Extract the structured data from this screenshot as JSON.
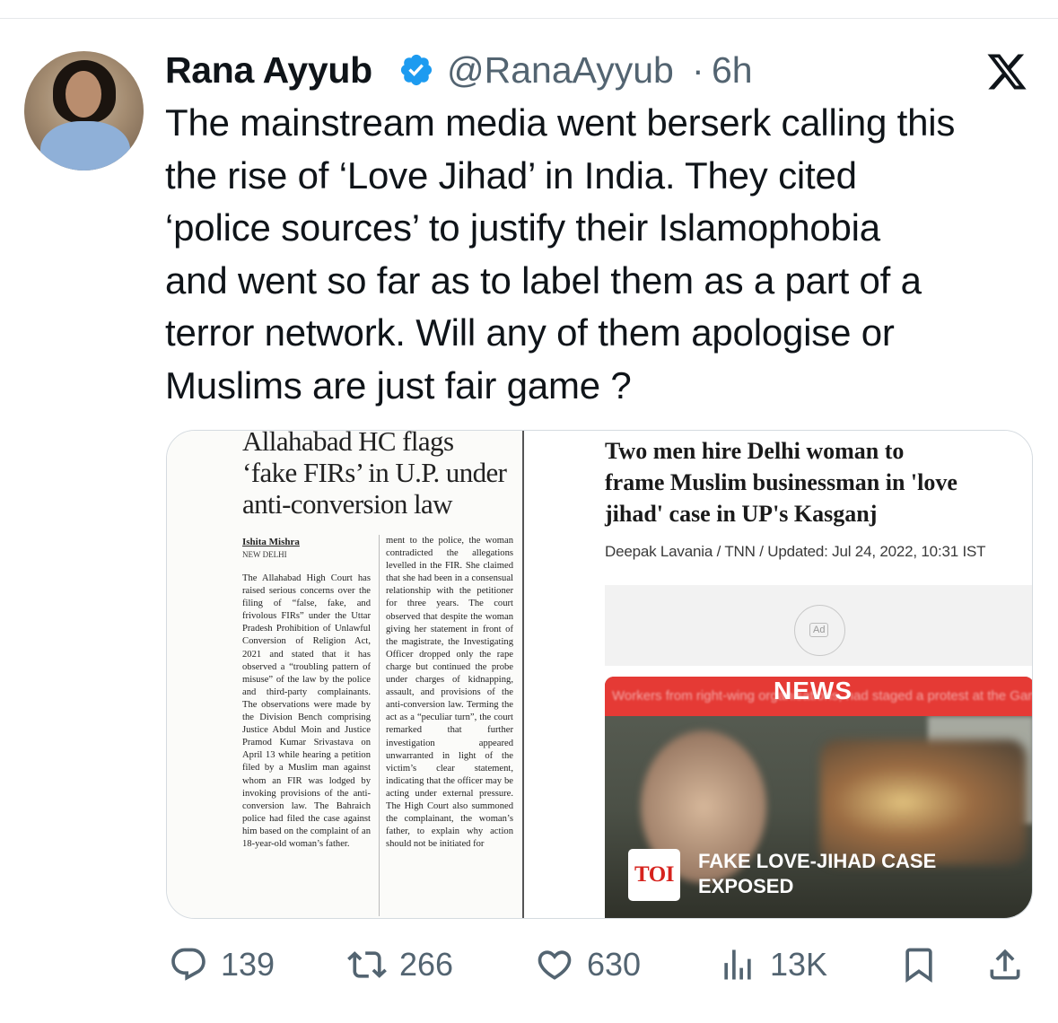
{
  "author": {
    "name": "Rana Ayyub",
    "handle": "@RanaAyyub",
    "separator": "·",
    "time": "6h"
  },
  "tweet": {
    "lines": [
      "The mainstream media went berserk calling this",
      "the rise of ‘Love Jihad’ in India. They cited",
      "‘police sources’ to justify their Islamophobia",
      "and went so far as to label them as a part of a",
      "terror network. Will any of them apologise or",
      "Muslims are just fair game ?"
    ]
  },
  "clip": {
    "headline": [
      "Allahabad HC flags",
      "‘fake FIRs’ in U.P. under",
      "anti-conversion law"
    ],
    "byline": "Ishita Mishra",
    "dateline": "NEW DELHI",
    "col1": "The Allahabad High Court has raised serious concerns over the filing of “false, fake, and frivolous FIRs” under the Uttar Pradesh Prohibition of Unlawful Conversion of Religion Act, 2021 and stated that it has observed a “troubling pattern of misuse” of the law by the police and third-party complainants. The observations were made by the Division Bench comprising Justice Abdul Moin and Justice Pramod Kumar Srivastava on April 13 while hearing a petition filed by a Muslim man against whom an FIR was lodged by invoking provisions of the anti-conversion law. The Bahraich police had filed the case against him based on the complaint of an 18-year-old woman’s father.",
    "col2": "ment to the police, the woman contradicted the allegations levelled in the FIR. She claimed that she had been in a consensual relationship with the petitioner for three years. The court observed that despite the woman giving her statement in front of the magistrate, the Investigating Officer dropped only the rape charge but continued the probe under charges of kidnapping, assault, and provisions of the anti-conversion law. Terming the act as a “peculiar turn”, the court remarked that further investigation appeared unwarranted in light of the victim’s clear statement, indicating that the officer may be acting under external pressure. The High Court also summoned the complainant, the woman’s father, to explain why action should not be initiated for"
  },
  "toi": {
    "headline": [
      "Two men hire Delhi woman to",
      "frame Muslim businessman in 'love",
      "jihad' case in UP's Kasganj"
    ],
    "meta": "Deepak Lavania / TNN / Updated: Jul 24, 2022, 10:31 IST",
    "ad_label": "Ad",
    "video_banner": "NEWS",
    "video_caption": "Workers from right-wing organisations, had staged a protest at the Ganjdundwara police station regarding the...",
    "logo_text": "TOI",
    "tag": [
      "FAKE LOVE-JIHAD CASE",
      "EXPOSED"
    ]
  },
  "actions": {
    "replies": "139",
    "reposts": "266",
    "likes": "630",
    "views": "13K"
  },
  "colors": {
    "text": "#0f1419",
    "muted": "#536471",
    "verified": "#1d9bf0",
    "news_red": "#e53a35"
  },
  "icons": [
    "verified-badge-icon",
    "x-logo-icon",
    "reply-icon",
    "repost-icon",
    "like-icon",
    "views-icon",
    "bookmark-icon",
    "share-icon"
  ]
}
